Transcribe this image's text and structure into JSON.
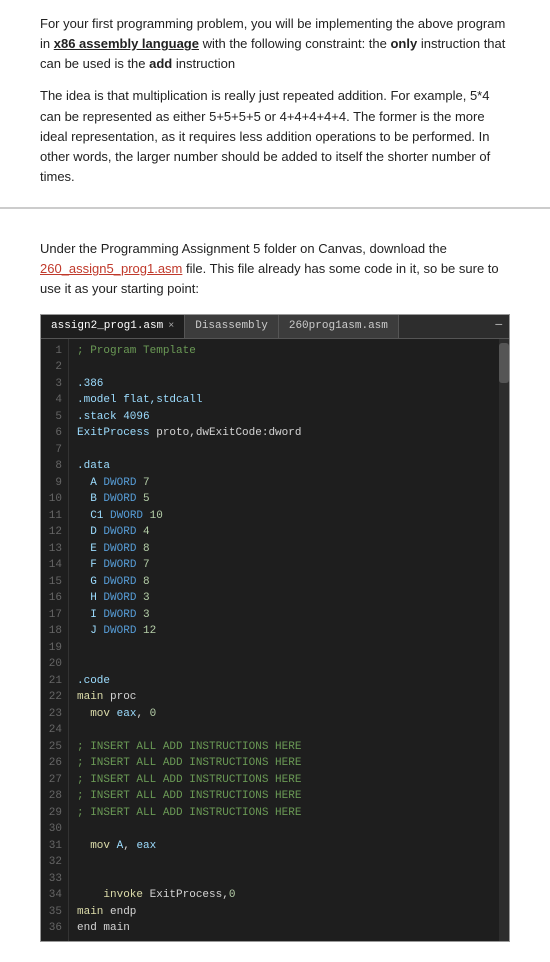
{
  "section1": {
    "para1_before": "For your first programming problem, you will be implementing the above program in ",
    "para1_link": "x86 assembly language",
    "para1_after_before_bold": " with the following constraint: the ",
    "para1_bold": "only",
    "para1_after": " instruction that can be used is the ",
    "para1_bold2": "add",
    "para1_end": " instruction",
    "para2": "The idea is that multiplication is really just repeated addition. For example, 5*4 can be represented as either 5+5+5+5 or 4+4+4+4+4. The former is the more ideal representation, as it requires less addition operations to be performed. In other words, the larger number should be added to itself the shorter number of times."
  },
  "section2": {
    "intro_before": "Under the Programming Assignment 5 folder on Canvas, download the ",
    "intro_link": "260_assign5_prog1.asm",
    "intro_after": " file. This file already has some code in it, so be sure to use it as your starting point:",
    "editor": {
      "tabs": [
        {
          "label": "assign2_prog1.asm",
          "active": true,
          "closable": true
        },
        {
          "label": "Disassembly",
          "active": false,
          "closable": false
        },
        {
          "label": "260prog1asm.asm",
          "active": false,
          "closable": false
        }
      ],
      "lines": [
        {
          "num": "1",
          "code": "; Program Template",
          "type": "comment"
        },
        {
          "num": "2",
          "code": "",
          "type": "plain"
        },
        {
          "num": "3",
          "code": ".386",
          "type": "directive"
        },
        {
          "num": "4",
          "code": ".model flat,stdcall",
          "type": "directive"
        },
        {
          "num": "5",
          "code": ".stack 4096",
          "type": "directive"
        },
        {
          "num": "6",
          "code": "ExitProcess proto,dwExitCode:dword",
          "type": "plain"
        },
        {
          "num": "7",
          "code": "",
          "type": "plain"
        },
        {
          "num": "8",
          "code": ".data",
          "type": "directive"
        },
        {
          "num": "9",
          "code": "  A DWORD 7",
          "type": "data"
        },
        {
          "num": "10",
          "code": "  B DWORD 5",
          "type": "data"
        },
        {
          "num": "11",
          "code": "  C1 DWORD 10",
          "type": "data"
        },
        {
          "num": "12",
          "code": "  D DWORD 4",
          "type": "data"
        },
        {
          "num": "13",
          "code": "  E DWORD 8",
          "type": "data"
        },
        {
          "num": "14",
          "code": "  F DWORD 7",
          "type": "data"
        },
        {
          "num": "15",
          "code": "  G DWORD 8",
          "type": "data"
        },
        {
          "num": "16",
          "code": "  H DWORD 3",
          "type": "data"
        },
        {
          "num": "17",
          "code": "  I DWORD 3",
          "type": "data"
        },
        {
          "num": "18",
          "code": "  J DWORD 12",
          "type": "data"
        },
        {
          "num": "19",
          "code": "",
          "type": "plain"
        },
        {
          "num": "20",
          "code": "",
          "type": "plain"
        },
        {
          "num": "21",
          "code": ".code",
          "type": "directive"
        },
        {
          "num": "22",
          "code": "main proc",
          "type": "plain"
        },
        {
          "num": "23",
          "code": "  mov eax, 0",
          "type": "instruction"
        },
        {
          "num": "24",
          "code": "",
          "type": "plain"
        },
        {
          "num": "25",
          "code": "; INSERT ALL ADD INSTRUCTIONS HERE",
          "type": "comment"
        },
        {
          "num": "26",
          "code": "; INSERT ALL ADD INSTRUCTIONS HERE",
          "type": "comment"
        },
        {
          "num": "27",
          "code": "; INSERT ALL ADD INSTRUCTIONS HERE",
          "type": "comment"
        },
        {
          "num": "28",
          "code": "; INSERT ALL ADD INSTRUCTIONS HERE",
          "type": "comment"
        },
        {
          "num": "29",
          "code": "; INSERT ALL ADD INSTRUCTIONS HERE",
          "type": "comment"
        },
        {
          "num": "30",
          "code": "",
          "type": "plain"
        },
        {
          "num": "31",
          "code": "  mov A, eax",
          "type": "instruction"
        },
        {
          "num": "32",
          "code": "",
          "type": "plain"
        },
        {
          "num": "33",
          "code": "",
          "type": "plain"
        },
        {
          "num": "34",
          "code": "    invoke ExitProcess,0",
          "type": "instruction"
        },
        {
          "num": "35",
          "code": "main endp",
          "type": "plain"
        },
        {
          "num": "36",
          "code": "end main",
          "type": "plain"
        }
      ]
    }
  }
}
